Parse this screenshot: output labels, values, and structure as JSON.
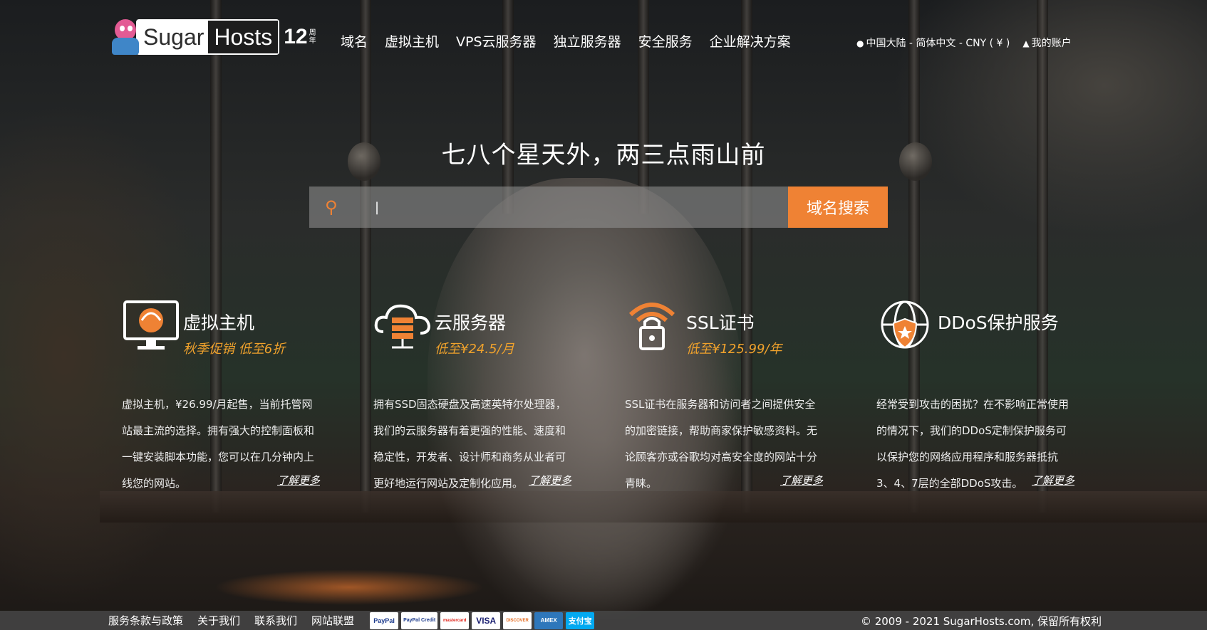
{
  "header": {
    "logo": {
      "brand_a": "Sugar",
      "brand_b": "Hosts",
      "years": "12",
      "years_unit": "周年"
    },
    "nav": [
      "域名",
      "虚拟主机",
      "VPS云服务器",
      "独立服务器",
      "安全服务",
      "企业解决方案"
    ],
    "locale": "中国大陆 - 简体中文 - CNY ( ¥ )",
    "account": "我的账户"
  },
  "hero": {
    "slogan": "七八个星天外，两三点雨山前",
    "search_value": "|",
    "search_button": "域名搜索"
  },
  "services": [
    {
      "title": "虚拟主机",
      "promo": "秋季促销 低至6折",
      "icon": "monitor-icon",
      "desc": "虚拟主机，¥26.99/月起售，当前托管网站最主流的选择。拥有强大的控制面板和一键安装脚本功能，您可以在几分钟内上线您的网站。",
      "more": "了解更多"
    },
    {
      "title": "云服务器",
      "promo": "低至¥24.5/月",
      "icon": "cloud-server-icon",
      "desc": "拥有SSD固态硬盘及高速英特尔处理器，我们的云服务器有着更强的性能、速度和稳定性，开发者、设计师和商务从业者可更好地运行网站及定制化应用。",
      "more": "了解更多"
    },
    {
      "title": "SSL证书",
      "promo": "低至¥125.99/年",
      "icon": "lock-wifi-icon",
      "desc": "SSL证书在服务器和访问者之间提供安全的加密链接，帮助商家保护敏感资料。无论顾客亦或谷歌均对高安全度的网站十分青睐。",
      "more": "了解更多"
    },
    {
      "title": "DDoS保护服务",
      "promo": "",
      "icon": "shield-globe-icon",
      "desc": "经常受到攻击的困扰？在不影响正常使用的情况下，我们的DDoS定制保护服务可以保护您的网络应用程序和服务器抵抗3、4、7层的全部DDoS攻击。",
      "more": "了解更多"
    }
  ],
  "footer": {
    "links": [
      "服务条款与政策",
      "关于我们",
      "联系我们",
      "网站联盟"
    ],
    "payments": [
      "PayPal",
      "PayPal Credit",
      "mastercard",
      "VISA",
      "DISCOVER",
      "AMEX",
      "支付宝"
    ],
    "copyright": "© 2009 - 2021 SugarHosts.com, 保留所有权利"
  },
  "colors": {
    "accent": "#ef8234",
    "promo": "#f0a22c"
  }
}
